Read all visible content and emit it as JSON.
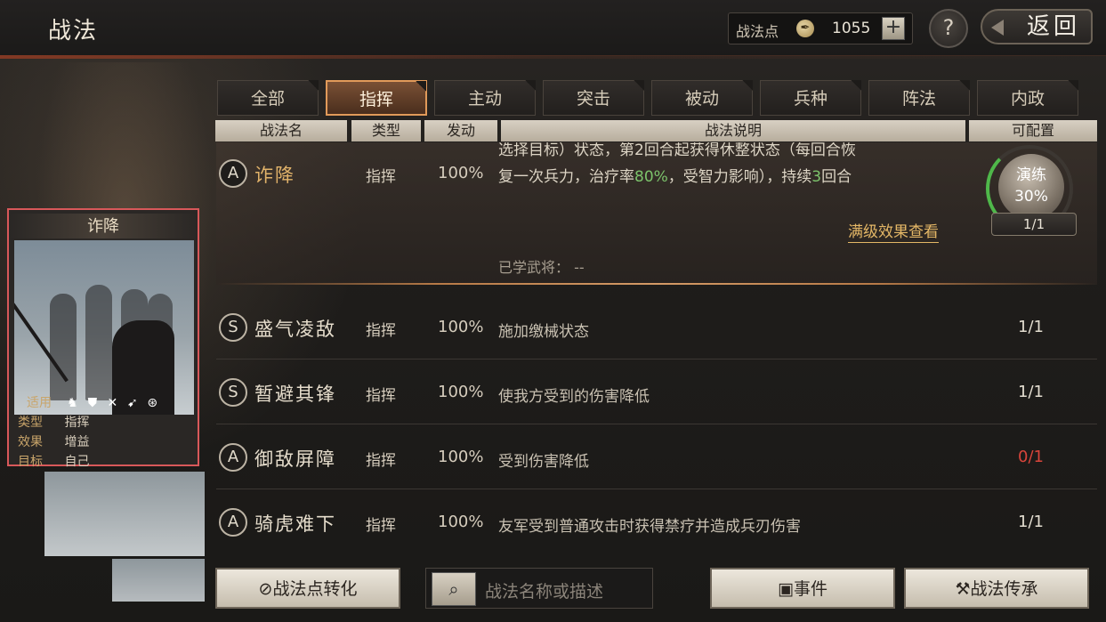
{
  "header": {
    "title": "战法",
    "points_label": "战法点",
    "points_value": "1055",
    "plus_label": "+",
    "help_label": "?",
    "back_label": "返回"
  },
  "tabs": [
    {
      "label": "全部"
    },
    {
      "label": "指挥"
    },
    {
      "label": "主动"
    },
    {
      "label": "突击"
    },
    {
      "label": "被动"
    },
    {
      "label": "兵种"
    },
    {
      "label": "阵法"
    },
    {
      "label": "内政"
    }
  ],
  "columns": {
    "name": "战法名",
    "type": "类型",
    "trigger": "发动",
    "desc": "战法说明",
    "config": "可配置"
  },
  "selected": {
    "rank": "A",
    "name": "诈降",
    "type": "指挥",
    "trigger": "100%",
    "desc_line1": "选择目标）状态，第2回合起获得休整状态（每回合恢",
    "desc_line2_a": "复一次兵力，治疗率",
    "desc_line2_hl1": "80%",
    "desc_line2_b": "，受智力影响），持续",
    "desc_line2_hl2": "3",
    "desc_line2_c": "回合",
    "full_effect_link": "满级效果查看",
    "learned_label": "已学武将：",
    "learned_value": "--",
    "train_label": "演练",
    "train_value": "30%",
    "config": "1/1"
  },
  "rows": [
    {
      "rank": "S",
      "name": "盛气凌敌",
      "type": "指挥",
      "trigger": "100%",
      "desc": "施加缴械状态",
      "config": "1/1"
    },
    {
      "rank": "S",
      "name": "暂避其锋",
      "type": "指挥",
      "trigger": "100%",
      "desc": "使我方受到的伤害降低",
      "config": "1/1"
    },
    {
      "rank": "A",
      "name": "御敌屏障",
      "type": "指挥",
      "trigger": "100%",
      "desc": "受到伤害降低",
      "config": "0/1"
    },
    {
      "rank": "A",
      "name": "骑虎难下",
      "type": "指挥",
      "trigger": "100%",
      "desc": "友军受到普通攻击时获得禁疗并造成兵刃伤害",
      "config": "1/1"
    }
  ],
  "card": {
    "name": "诈降",
    "apply_label": "适用",
    "type_label": "类型",
    "type_value": "指挥",
    "effect_label": "效果",
    "effect_value": "增益",
    "target_label": "目标",
    "target_value": "自己"
  },
  "bottom": {
    "convert_label": "战法点转化",
    "search_placeholder": "战法名称或描述",
    "event_label": "事件",
    "inherit_label": "战法传承"
  },
  "colors": {
    "accent": "#e19a5a",
    "highlight_green": "#7cc36b",
    "warning_red": "#d8453b",
    "card_border": "#d8585a"
  }
}
